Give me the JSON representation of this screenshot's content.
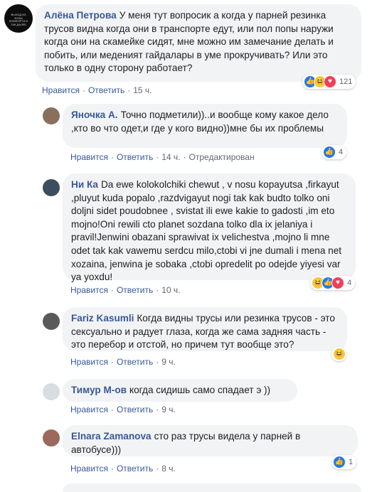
{
  "colors": {
    "author": "#385898",
    "bubble": "#f2f3f5",
    "meta": "#606770",
    "like": "#2078f4",
    "haha": "#f7c744",
    "love": "#f33e58"
  },
  "actions": {
    "like": "Нравится",
    "reply": "Ответить",
    "edited": "Отредактирован"
  },
  "comments": [
    {
      "author": "Алёна Петрова",
      "text": "У меня тут вопросик а когда у парней резинка трусов видна когда они в транспорте едут, или пол попы наружи когда они на скамейке сидят, мне можно им замечание делать и побить, или меденият гайдалары в уме прокручивать? Или это только в одну сторону работает?",
      "time": "15 ч.",
      "reactions": [
        "like-icon",
        "haha-icon",
        "love-icon"
      ],
      "count": "121",
      "avatar_caption": "ВЫХОД ИЗ ЗОНЫ КОМФОРТА И ТАК ДАЛЕЕ"
    },
    {
      "author": "Яночка А.",
      "text": "Точно подметили))..и вообще кому какое дело ,кто во что одет,и где у кого видно))мне бы их проблемы",
      "time": "14 ч.",
      "edited": true,
      "reactions": [
        "like-icon"
      ],
      "count": "4"
    },
    {
      "author": "Ни Ка",
      "text": "Da ewe kolokolchiki chewut , v nosu kopayutsa ,firkayut ,pluyut kuda popalo ,razdvigayut nogi tak kak budto tolko oni doljni sidet poudobnee , svistat ili ewe kakie to gadosti ,im eto mojno!Oni rewili cto planet sozdana tolko dla ix jelaniya i pravil!Jenwini obazani sprawivat ix velichestva ,mojno li mne odet tak kak vawemu serdcu milo,ctobi vi jne dumali i mena net xozaina, jenwina je sobaka ,ctobi opredelit po odejde yiyesi var ya yoxdu!",
      "time": "10 ч.",
      "reactions": [
        "haha-icon",
        "like-icon",
        "love-icon"
      ],
      "count": "4"
    },
    {
      "author": "Fariz Kasumli",
      "text": "Когда видны трусы или резинка трусов - это сексуально и радует глаза, когда же сама задняя часть - это перебор и отстой, но причем тут вообще это?",
      "time": "9 ч.",
      "reactions": [
        "haha-icon"
      ],
      "count": ""
    },
    {
      "author": "Тимур М-ов",
      "text": "когда сидишь само спадает э ))",
      "time": "9 ч.",
      "reactions": [],
      "count": ""
    },
    {
      "author": "Elnara Zamanova",
      "text": "сто раз трусы видела у парней в автобусе)))",
      "time": "8 ч.",
      "reactions": [
        "like-icon"
      ],
      "count": "1"
    }
  ]
}
